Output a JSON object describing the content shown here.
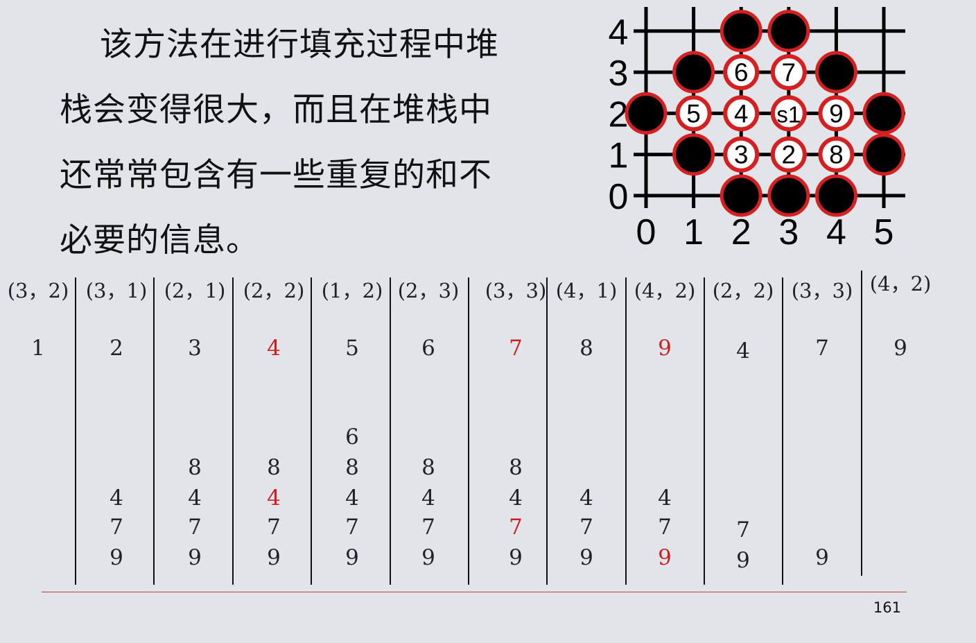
{
  "paragraph_lines": [
    "该方法在进行填充过程中堆",
    "栈会变得很大，而且在堆栈中",
    "还常常包含有一些重复的和不",
    "必要的信息。"
  ],
  "grid": {
    "x_axis": [
      "0",
      "1",
      "2",
      "3",
      "4",
      "5"
    ],
    "y_axis": [
      "0",
      "1",
      "2",
      "3",
      "4"
    ],
    "pixels": [
      {
        "x": 2,
        "y": 4,
        "kind": "boundary",
        "label": ""
      },
      {
        "x": 3,
        "y": 4,
        "kind": "boundary",
        "label": ""
      },
      {
        "x": 1,
        "y": 3,
        "kind": "boundary",
        "label": ""
      },
      {
        "x": 2,
        "y": 3,
        "kind": "seed",
        "label": "6"
      },
      {
        "x": 3,
        "y": 3,
        "kind": "seed",
        "label": "7"
      },
      {
        "x": 4,
        "y": 3,
        "kind": "boundary",
        "label": ""
      },
      {
        "x": 0,
        "y": 2,
        "kind": "boundary",
        "label": ""
      },
      {
        "x": 1,
        "y": 2,
        "kind": "seed",
        "label": "5"
      },
      {
        "x": 2,
        "y": 2,
        "kind": "seed",
        "label": "4"
      },
      {
        "x": 3,
        "y": 2,
        "kind": "seed",
        "label": "s1"
      },
      {
        "x": 4,
        "y": 2,
        "kind": "seed",
        "label": "9"
      },
      {
        "x": 5,
        "y": 2,
        "kind": "boundary",
        "label": ""
      },
      {
        "x": 1,
        "y": 1,
        "kind": "boundary",
        "label": ""
      },
      {
        "x": 2,
        "y": 1,
        "kind": "seed",
        "label": "3"
      },
      {
        "x": 3,
        "y": 1,
        "kind": "seed",
        "label": "2"
      },
      {
        "x": 4,
        "y": 1,
        "kind": "seed",
        "label": "8"
      },
      {
        "x": 5,
        "y": 1,
        "kind": "boundary",
        "label": ""
      },
      {
        "x": 2,
        "y": 0,
        "kind": "boundary",
        "label": ""
      },
      {
        "x": 3,
        "y": 0,
        "kind": "boundary",
        "label": ""
      },
      {
        "x": 4,
        "y": 0,
        "kind": "boundary",
        "label": ""
      }
    ]
  },
  "stack_table": {
    "columns": [
      {
        "coord": "(3，2)",
        "popped": {
          "v": "1",
          "red": false
        },
        "stack": []
      },
      {
        "coord": "(3，1)",
        "popped": {
          "v": "2",
          "red": false
        },
        "stack": [
          {
            "v": "4",
            "red": false
          },
          {
            "v": "7",
            "red": false
          },
          {
            "v": "9",
            "red": false
          }
        ]
      },
      {
        "coord": "(2，1)",
        "popped": {
          "v": "3",
          "red": false
        },
        "stack": [
          {
            "v": "8",
            "red": false
          },
          {
            "v": "4",
            "red": false
          },
          {
            "v": "7",
            "red": false
          },
          {
            "v": "9",
            "red": false
          }
        ]
      },
      {
        "coord": "(2，2)",
        "popped": {
          "v": "4",
          "red": true
        },
        "stack": [
          {
            "v": "8",
            "red": false
          },
          {
            "v": "4",
            "red": true
          },
          {
            "v": "7",
            "red": false
          },
          {
            "v": "9",
            "red": false
          }
        ]
      },
      {
        "coord": "(1，2)",
        "popped": {
          "v": "5",
          "red": false
        },
        "stack": [
          {
            "v": "6",
            "red": false
          },
          {
            "v": "8",
            "red": false
          },
          {
            "v": "4",
            "red": false
          },
          {
            "v": "7",
            "red": false
          },
          {
            "v": "9",
            "red": false
          }
        ]
      },
      {
        "coord": "(2，3)",
        "popped": {
          "v": "6",
          "red": false
        },
        "stack": [
          {
            "v": "8",
            "red": false
          },
          {
            "v": "4",
            "red": false
          },
          {
            "v": "7",
            "red": false
          },
          {
            "v": "9",
            "red": false
          }
        ]
      },
      {
        "coord": "(3，3)",
        "popped": {
          "v": "7",
          "red": true
        },
        "stack": [
          {
            "v": "8",
            "red": false
          },
          {
            "v": "4",
            "red": false
          },
          {
            "v": "7",
            "red": true
          },
          {
            "v": "9",
            "red": false
          }
        ]
      },
      {
        "coord": "(4，1)",
        "popped": {
          "v": "8",
          "red": false
        },
        "stack": [
          {
            "v": "4",
            "red": false
          },
          {
            "v": "7",
            "red": false
          },
          {
            "v": "9",
            "red": false
          }
        ]
      },
      {
        "coord": "(4，2)",
        "popped": {
          "v": "9",
          "red": true
        },
        "stack": [
          {
            "v": "4",
            "red": false
          },
          {
            "v": "7",
            "red": false
          },
          {
            "v": "9",
            "red": true
          }
        ]
      },
      {
        "coord": "(2，2)",
        "popped": {
          "v": "4",
          "red": false
        },
        "stack": [
          {
            "v": "7",
            "red": false
          },
          {
            "v": "9",
            "red": false
          }
        ]
      },
      {
        "coord": "(3，3)",
        "popped": {
          "v": "7",
          "red": false
        },
        "stack": [
          {
            "v": "9",
            "red": false
          }
        ]
      },
      {
        "coord": "(4，2)",
        "popped": {
          "v": "9",
          "red": false
        },
        "stack": []
      }
    ]
  },
  "page_number": "161",
  "colors": {
    "background": "#e1e4e9",
    "boundary_fill": "#000000",
    "ring": "#d42020",
    "highlight_text": "#cc1f1f",
    "rule": "#c0392b"
  }
}
